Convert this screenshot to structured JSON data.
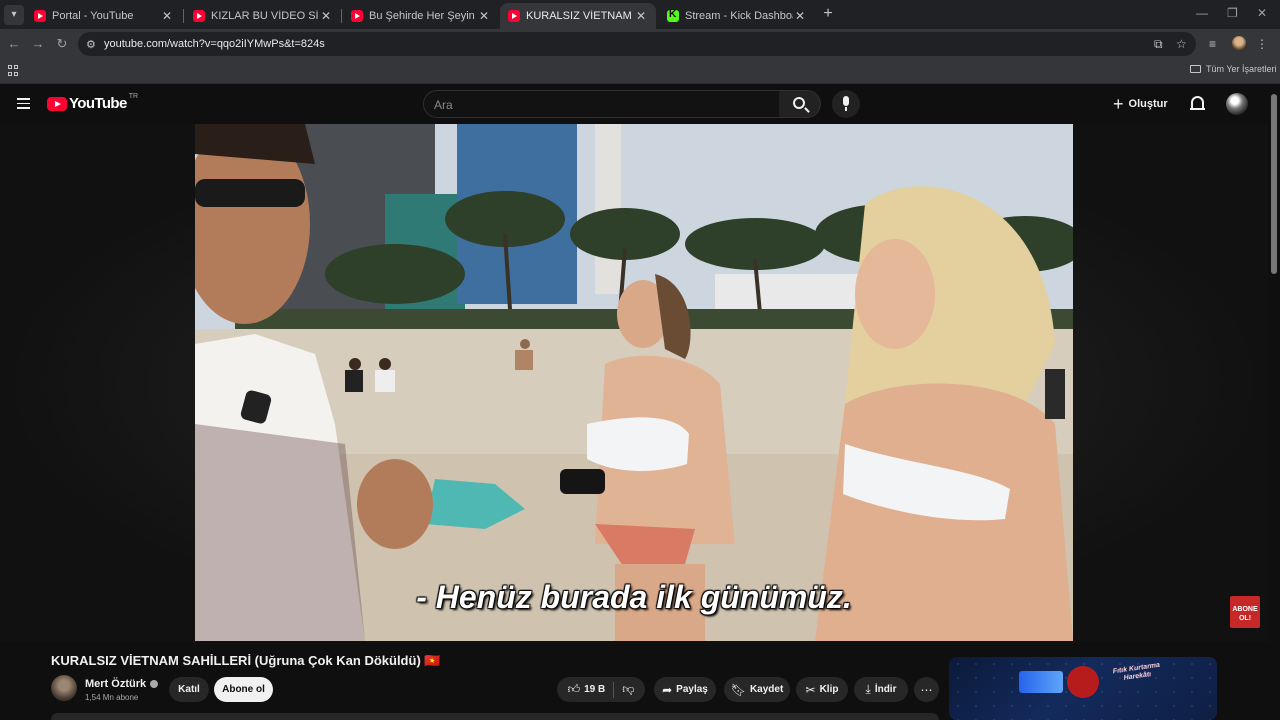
{
  "browser": {
    "tabs": [
      {
        "title": "Portal - YouTube",
        "favicon": "youtube-icon",
        "active": false
      },
      {
        "title": "KIZLAR BU VİDEO SİZE - YouTube",
        "favicon": "youtube-icon",
        "active": false
      },
      {
        "title": "Bu Şehirde Her Şeyin bir FİYATI",
        "favicon": "youtube-icon",
        "active": false
      },
      {
        "title": "KURALSIZ VİETNAM SAHİLLERİ",
        "favicon": "youtube-icon",
        "active": true
      },
      {
        "title": "Stream - Kick Dashboard",
        "favicon": "kick-icon",
        "active": false
      }
    ],
    "url": "youtube.com/watch?v=qqo2iIYMwPs&t=824s",
    "bookmarks_folder": "Tüm Yer İşaretleri"
  },
  "masthead": {
    "logo_text": "YouTube",
    "country_code": "TR",
    "search_placeholder": "Ara",
    "create_label": "Oluştur"
  },
  "player": {
    "subtitle": "- Henüz burada ilk günümüz.",
    "corner_badge": "ABONE OL!"
  },
  "video": {
    "title": "KURALSIZ VİETNAM SAHİLLERİ (Uğruna Çok Kan Döküldü) 🇻🇳",
    "channel_name": "Mert Öztürk",
    "subscribers": "1,54 Mn abone",
    "join_label": "Katıl",
    "subscribe_label": "Abone ol",
    "like_count": "19 B",
    "share_label": "Paylaş",
    "save_label": "Kaydet",
    "clip_label": "Klip",
    "download_label": "İndir"
  },
  "ad": {
    "text": "Fıtık Kurtarma Harekâtı"
  },
  "colors": {
    "brand_red": "#ff0033",
    "background": "#0f0f0f",
    "kick_green": "#53fc18"
  }
}
